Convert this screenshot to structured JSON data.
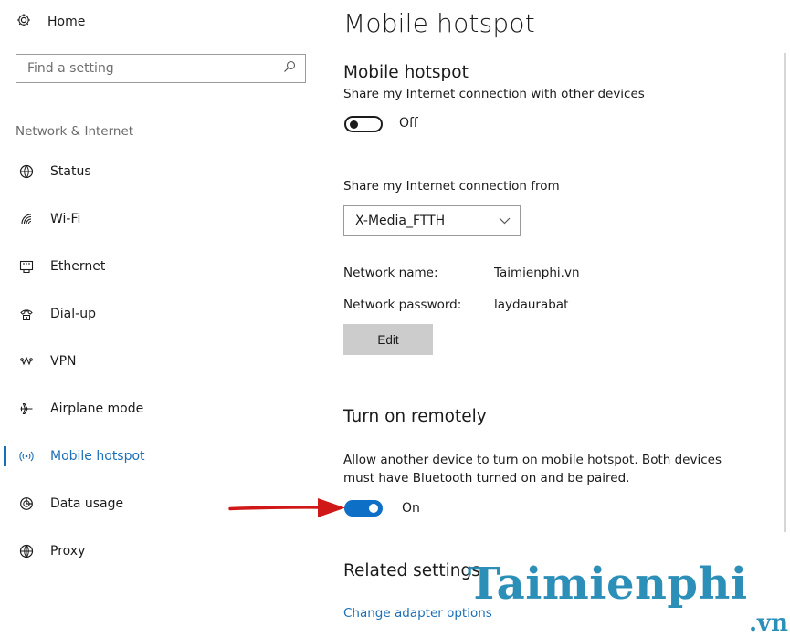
{
  "sidebar": {
    "home_label": "Home",
    "search_placeholder": "Find a setting",
    "section_label": "Network & Internet",
    "items": [
      {
        "label": "Status",
        "icon": "status-globe-icon"
      },
      {
        "label": "Wi-Fi",
        "icon": "wifi-icon"
      },
      {
        "label": "Ethernet",
        "icon": "ethernet-icon"
      },
      {
        "label": "Dial-up",
        "icon": "dialup-icon"
      },
      {
        "label": "VPN",
        "icon": "vpn-icon"
      },
      {
        "label": "Airplane mode",
        "icon": "airplane-icon"
      },
      {
        "label": "Mobile hotspot",
        "icon": "hotspot-icon",
        "active": true
      },
      {
        "label": "Data usage",
        "icon": "data-usage-icon"
      },
      {
        "label": "Proxy",
        "icon": "proxy-globe-icon"
      }
    ]
  },
  "main": {
    "page_title": "Mobile hotspot",
    "hotspot": {
      "heading": "Mobile hotspot",
      "description": "Share my Internet connection with other devices",
      "toggle_state": "Off"
    },
    "share_from": {
      "label": "Share my Internet connection from",
      "selected": "X-Media_FTTH"
    },
    "network": {
      "name_label": "Network name:",
      "name_value": "Taimienphi.vn",
      "password_label": "Network password:",
      "password_value": "laydaurabat",
      "edit_button": "Edit"
    },
    "remote": {
      "heading": "Turn on remotely",
      "description_line1": "Allow another device to turn on mobile hotspot. Both devices",
      "description_line2": "must have Bluetooth turned on and be paired.",
      "toggle_state": "On"
    },
    "related": {
      "heading": "Related settings",
      "link": "Change adapter options"
    }
  },
  "watermark": {
    "text": "Taimienphi",
    "suffix": ".vn"
  },
  "colors": {
    "accent": "#1a6fb8",
    "toggle_on": "#0d6fc5",
    "arrow": "#d01818",
    "watermark": "#1b86b3"
  }
}
